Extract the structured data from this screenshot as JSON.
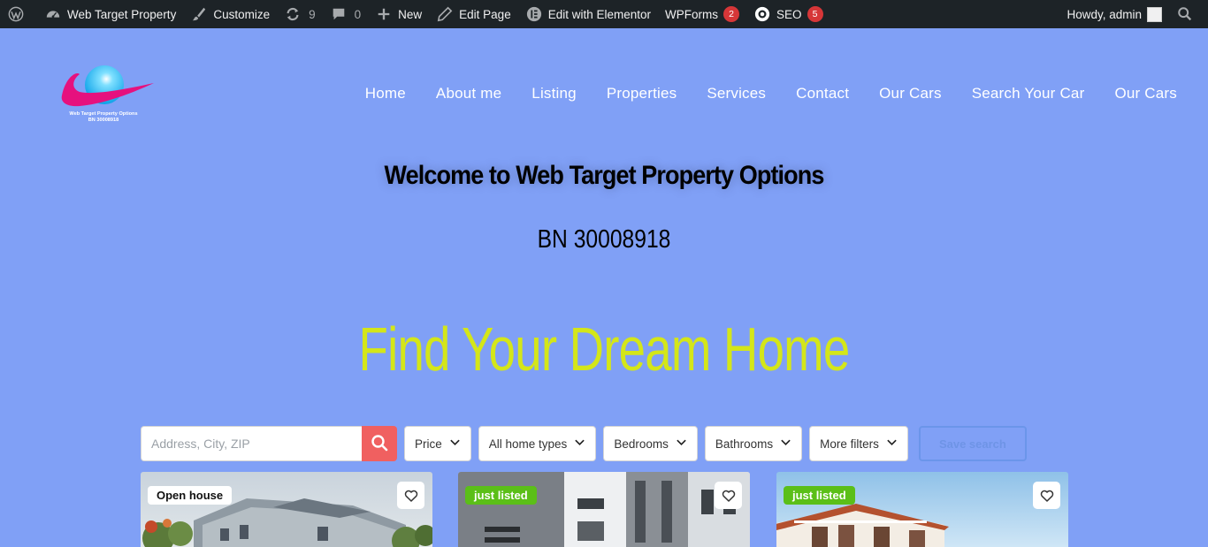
{
  "adminbar": {
    "site_name": "Web Target Property",
    "customize": "Customize",
    "updates_count": "9",
    "comments_count": "0",
    "new": "New",
    "edit_page": "Edit Page",
    "elementor": "Edit with Elementor",
    "wpforms": "WPForms",
    "wpforms_badge": "2",
    "seo": "SEO",
    "seo_badge": "5",
    "howdy": "Howdy, admin"
  },
  "logo": {
    "line1": "Web Target Property Options",
    "line2": "BN 30008918"
  },
  "nav": [
    "Home",
    "About me",
    "Listing",
    "Properties",
    "Services",
    "Contact",
    "Our Cars",
    "Search Your Car",
    "Our Cars"
  ],
  "hero": {
    "welcome": "Welcome to Web Target Property Options",
    "bn": "BN 30008918",
    "headline": "Find Your Dream Home"
  },
  "search": {
    "placeholder": "Address, City, ZIP",
    "filters": [
      "Price",
      "All home types",
      "Bedrooms",
      "Bathrooms",
      "More filters"
    ],
    "save_label": "Save search"
  },
  "cards": [
    {
      "tag": "Open house",
      "tag_style": "open"
    },
    {
      "tag": "just listed",
      "tag_style": "listed"
    },
    {
      "tag": "just listed",
      "tag_style": "listed"
    }
  ],
  "colors": {
    "page_bg": "#80a0f6",
    "headline": "#d4e619",
    "search_button": "#f06060",
    "badge_red": "#d63638",
    "listed_green": "#5bbf18"
  }
}
